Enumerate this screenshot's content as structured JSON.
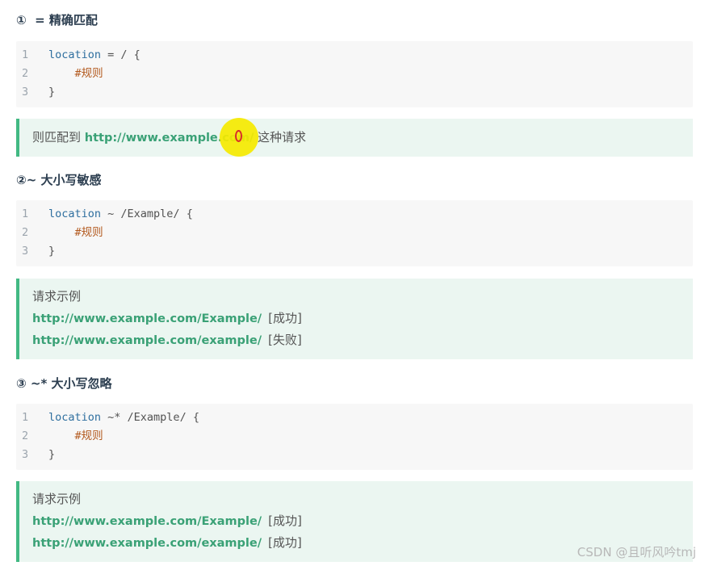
{
  "sections": [
    {
      "heading": "①  = 精确匹配",
      "code": [
        {
          "num": "1",
          "kw": "location",
          "rest": " = / {",
          "comment": ""
        },
        {
          "num": "2",
          "kw": "",
          "rest": "",
          "comment": "    #规则"
        },
        {
          "num": "3",
          "kw": "",
          "rest": "}",
          "comment": ""
        }
      ],
      "tip_prefix": "则匹配到 ",
      "tip_link": "http://www.example.com/",
      "tip_suffix": " 这种请求"
    },
    {
      "heading": "②~ 大小写敏感",
      "code": [
        {
          "num": "1",
          "kw": "location",
          "rest": " ~ /Example/ {",
          "comment": ""
        },
        {
          "num": "2",
          "kw": "",
          "rest": "",
          "comment": "    #规则"
        },
        {
          "num": "3",
          "kw": "",
          "rest": "}",
          "comment": ""
        }
      ],
      "tip_title": "请求示例",
      "examples": [
        {
          "url": "http://www.example.com/Example/",
          "status": "[成功]"
        },
        {
          "url": "http://www.example.com/example/",
          "status": "[失败]"
        }
      ]
    },
    {
      "heading": "③ ~* 大小写忽略",
      "code": [
        {
          "num": "1",
          "kw": "location",
          "rest": " ~* /Example/ {",
          "comment": ""
        },
        {
          "num": "2",
          "kw": "",
          "rest": "",
          "comment": "    #规则"
        },
        {
          "num": "3",
          "kw": "",
          "rest": "}",
          "comment": ""
        }
      ],
      "tip_title": "请求示例",
      "examples": [
        {
          "url": "http://www.example.com/Example/",
          "status": "[成功]"
        },
        {
          "url": "http://www.example.com/example/",
          "status": "[成功]"
        }
      ]
    }
  ],
  "watermark": "CSDN @且听风吟tmj",
  "colors": {
    "accent": "#42b983",
    "link": "#3aa176",
    "tip_bg": "#ebf6f1",
    "code_bg": "#f7f7f7",
    "keyword": "#2f6f9f",
    "comment": "#b35a1f",
    "cursor": "#f5e900"
  }
}
